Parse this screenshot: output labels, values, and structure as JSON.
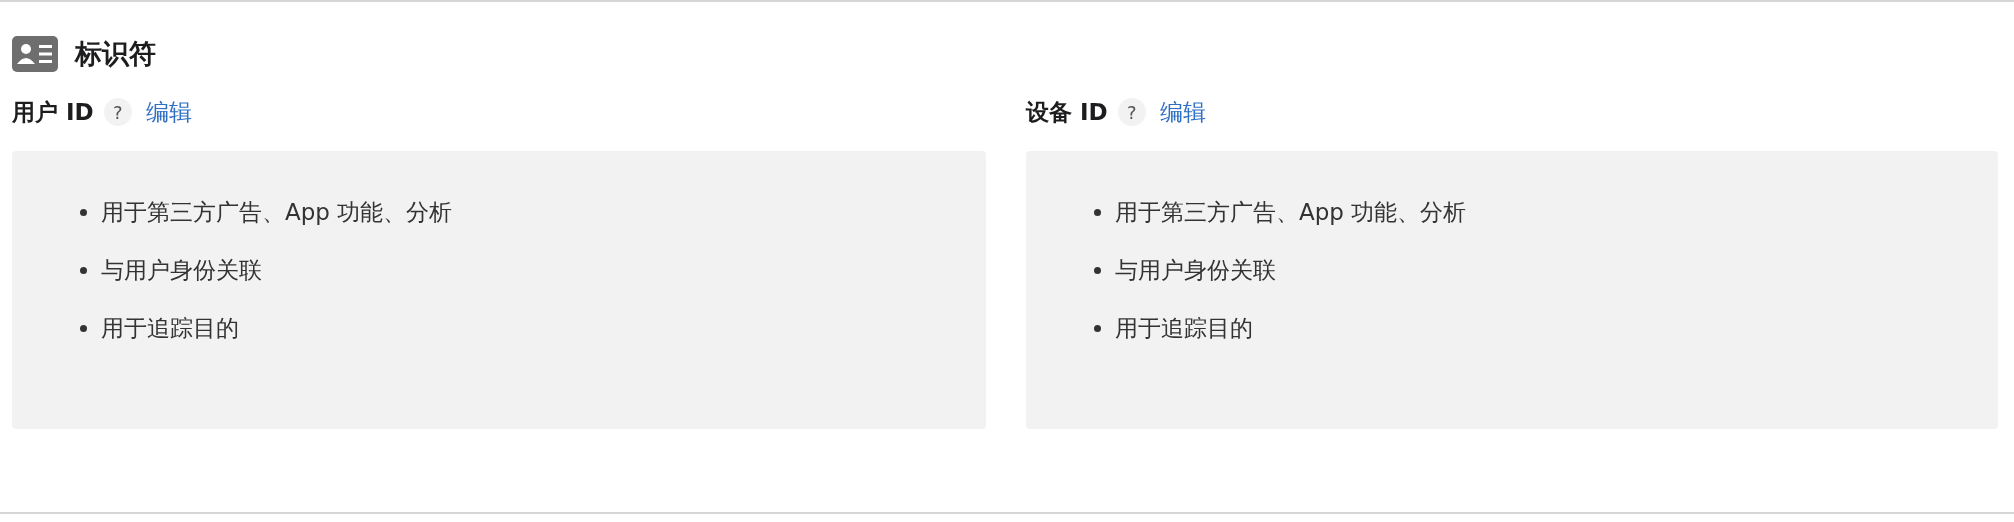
{
  "section": {
    "title": "标识符"
  },
  "identifiers": [
    {
      "label": "用户 ID",
      "help": "?",
      "edit": "编辑",
      "items": [
        "用于第三方广告、App 功能、分析",
        "与用户身份关联",
        "用于追踪目的"
      ]
    },
    {
      "label": "设备 ID",
      "help": "?",
      "edit": "编辑",
      "items": [
        "用于第三方广告、App 功能、分析",
        "与用户身份关联",
        "用于追踪目的"
      ]
    }
  ]
}
